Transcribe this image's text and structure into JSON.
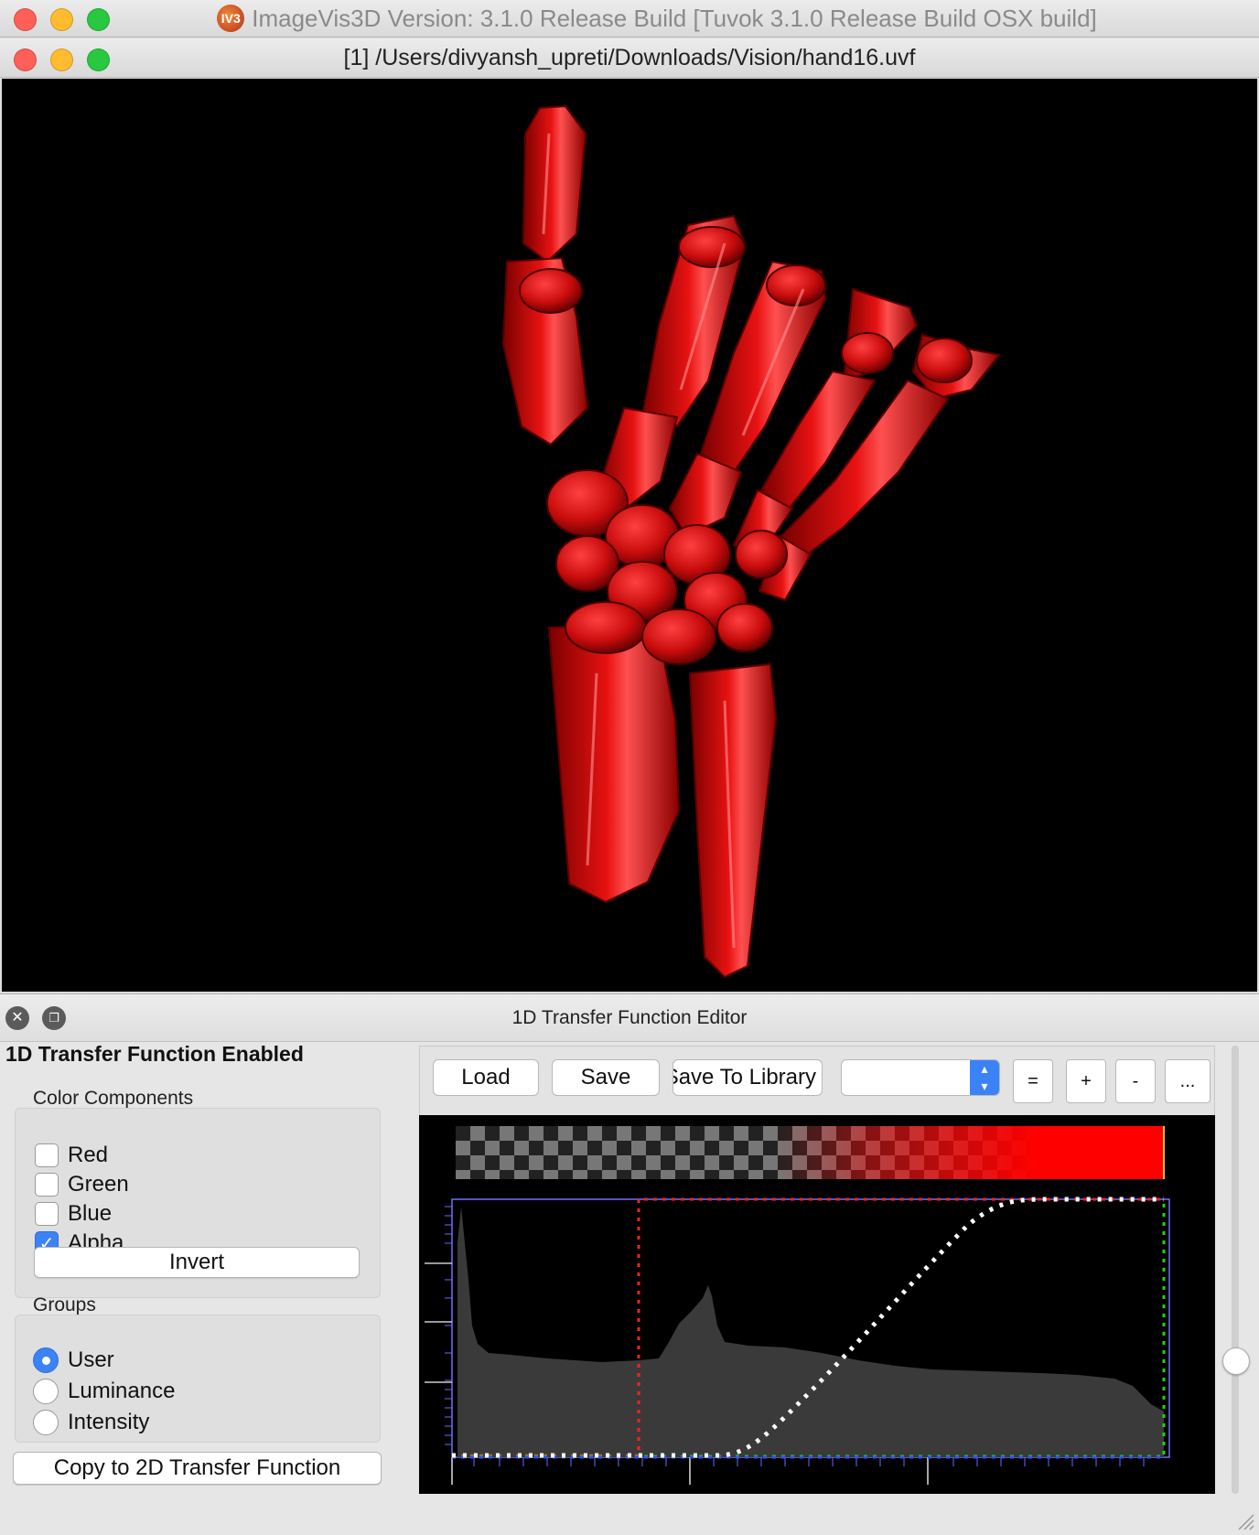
{
  "app": {
    "window_title": "ImageVis3D Version: 3.1.0 Release Build [Tuvok 3.1.0 Release Build OSX build]",
    "app_icon_text": "IV3",
    "document_title": "[1] /Users/divyansh_upreti/Downloads/Vision/hand16.uvf"
  },
  "editor": {
    "title": "1D Transfer Function Editor",
    "enabled_label": "1D Transfer Function Enabled",
    "color_components": {
      "title": "Color Components",
      "items": [
        {
          "label": "Red",
          "checked": false
        },
        {
          "label": "Green",
          "checked": false
        },
        {
          "label": "Blue",
          "checked": false
        },
        {
          "label": "Alpha",
          "checked": true
        }
      ],
      "invert_label": "Invert"
    },
    "groups": {
      "title": "Groups",
      "items": [
        {
          "label": "User",
          "selected": true
        },
        {
          "label": "Luminance",
          "selected": false
        },
        {
          "label": "Intensity",
          "selected": false
        }
      ]
    },
    "copy_label": "Copy to 2D Transfer Function",
    "toolbar": {
      "load": "Load",
      "save": "Save",
      "save_to_library": "Save To Library",
      "preset_value": "",
      "equal": "=",
      "plus": "+",
      "minus": "-",
      "more": "..."
    }
  },
  "colors": {
    "render_background": "#000000",
    "bone": "#e01010",
    "accent": "#3b82f6",
    "alpha_curve": "#ffffff",
    "red_channel": "#ff2020",
    "green_channel": "#20d020",
    "blue_channel": "#3050ff",
    "histogram": "#3a3a3a"
  }
}
